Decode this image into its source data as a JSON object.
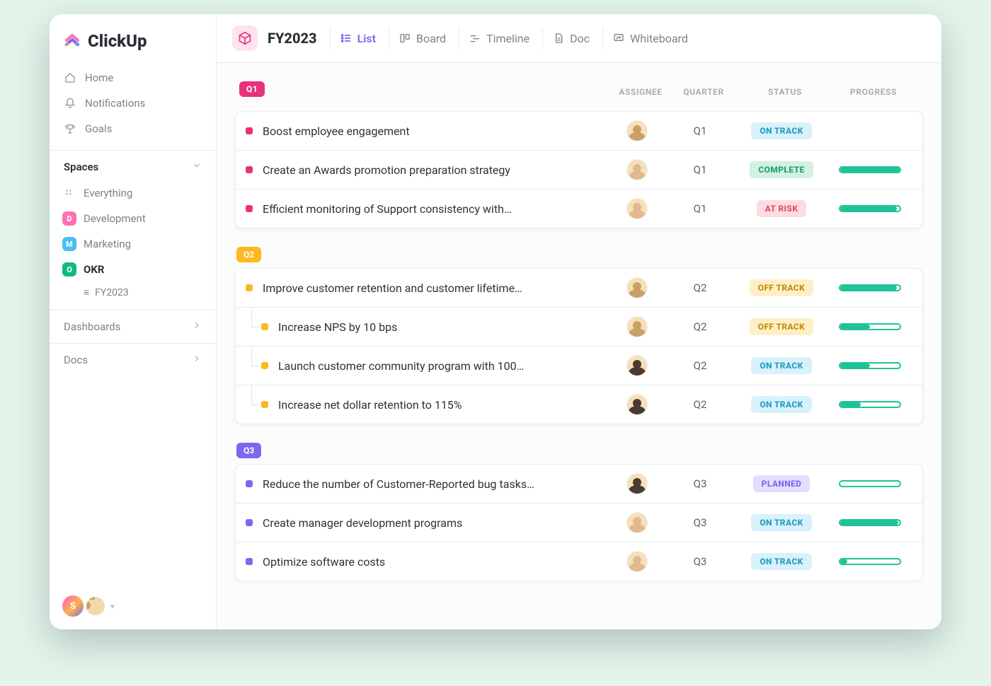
{
  "brand": "ClickUp",
  "sidebar": {
    "nav": [
      {
        "label": "Home"
      },
      {
        "label": "Notifications"
      },
      {
        "label": "Goals"
      }
    ],
    "spaces_header": "Spaces",
    "everything": "Everything",
    "spaces": [
      {
        "key": "D",
        "label": "Development",
        "color": "#fd71af"
      },
      {
        "key": "M",
        "label": "Marketing",
        "color": "#49c0f0"
      },
      {
        "key": "O",
        "label": "OKR",
        "color": "#12b886",
        "active": true
      }
    ],
    "okr_list_label": "FY2023",
    "links": [
      {
        "label": "Dashboards"
      },
      {
        "label": "Docs"
      }
    ],
    "footer_initial": "S"
  },
  "header": {
    "breadcrumb": "FY2023",
    "views": [
      {
        "label": "List",
        "active": true
      },
      {
        "label": "Board"
      },
      {
        "label": "Timeline"
      },
      {
        "label": "Doc"
      },
      {
        "label": "Whiteboard"
      }
    ]
  },
  "columns": {
    "assignee": "ASSIGNEE",
    "quarter": "QUARTER",
    "status": "STATUS",
    "progress": "PROGRESS"
  },
  "status_styles": {
    "ON TRACK": {
      "bg": "#d8f2fb",
      "tx": "#259bc3"
    },
    "COMPLETE": {
      "bg": "#d3f0e2",
      "tx": "#1da362"
    },
    "AT RISK": {
      "bg": "#fddce1",
      "tx": "#e04f62"
    },
    "OFF TRACK": {
      "bg": "#feefc7",
      "tx": "#c58b09"
    },
    "PLANNED": {
      "bg": "#e3deff",
      "tx": "#7b68ee"
    }
  },
  "groups": [
    {
      "key": "Q1",
      "color": "#e8317a",
      "rows": [
        {
          "name": "Boost employee engagement",
          "quarter": "Q1",
          "status": "ON TRACK",
          "progress": null,
          "face": "tan"
        },
        {
          "name": "Create an Awards promotion preparation strategy",
          "quarter": "Q1",
          "status": "COMPLETE",
          "progress": 100,
          "face": "pale"
        },
        {
          "name": "Efficient monitoring of Support consistency with…",
          "quarter": "Q1",
          "status": "AT RISK",
          "progress": 95,
          "face": "pale"
        }
      ]
    },
    {
      "key": "Q2",
      "color": "#fdb81e",
      "rows": [
        {
          "name": "Improve customer retention and customer lifetime…",
          "quarter": "Q2",
          "status": "OFF TRACK",
          "progress": 95,
          "face": "tan"
        },
        {
          "name": "Increase NPS by 10 bps",
          "quarter": "Q2",
          "status": "OFF TRACK",
          "progress": 50,
          "face": "tan",
          "sub": true
        },
        {
          "name": "Launch customer community program with 100…",
          "quarter": "Q2",
          "status": "ON TRACK",
          "progress": 50,
          "face": "dark",
          "sub": true
        },
        {
          "name": "Increase net dollar retention to 115%",
          "quarter": "Q2",
          "status": "ON TRACK",
          "progress": 35,
          "face": "dark",
          "sub": true
        }
      ]
    },
    {
      "key": "Q3",
      "color": "#7b68ee",
      "rows": [
        {
          "name": "Reduce the number of Customer-Reported bug tasks…",
          "quarter": "Q3",
          "status": "PLANNED",
          "progress": 0,
          "face": "dark"
        },
        {
          "name": "Create manager development programs",
          "quarter": "Q3",
          "status": "ON TRACK",
          "progress": 98,
          "face": "pale"
        },
        {
          "name": "Optimize software costs",
          "quarter": "Q3",
          "status": "ON TRACK",
          "progress": 12,
          "face": "pale"
        }
      ]
    }
  ]
}
